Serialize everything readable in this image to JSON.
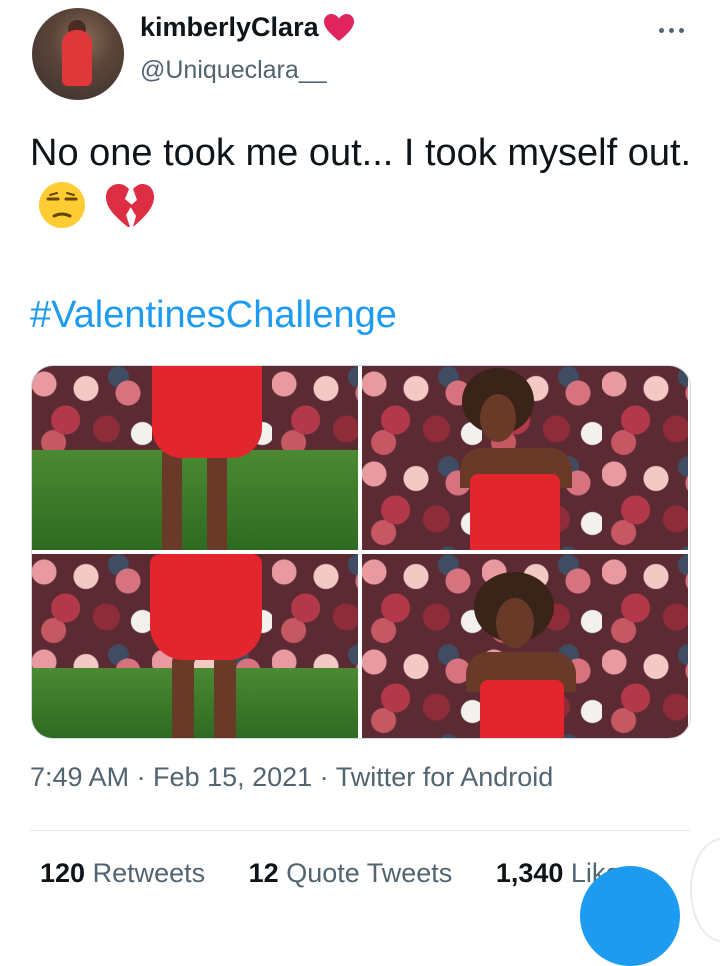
{
  "tweet": {
    "display_name": "kimberlyClara",
    "handle": "@Uniqueclara__",
    "text": "No one took me out... I took myself out.",
    "hashtag": "#ValentinesChallenge",
    "timestamp": "7:49 AM · Feb 15, 2021 · ",
    "source": "Twitter for Android",
    "stats": {
      "retweets_count": "120",
      "retweets_label": " Retweets",
      "quotes_count": "12",
      "quotes_label": " Quote Tweets",
      "likes_count": "1,340",
      "likes_label": " Likes"
    }
  },
  "icons": {
    "name_badge": "red-heart-icon",
    "emoji_1": "unamused-face-icon",
    "emoji_2": "broken-heart-icon",
    "more": "more-options-icon"
  },
  "colors": {
    "link": "#1d9bf0",
    "secondary_text": "#536471",
    "heart": "#e0245e"
  }
}
